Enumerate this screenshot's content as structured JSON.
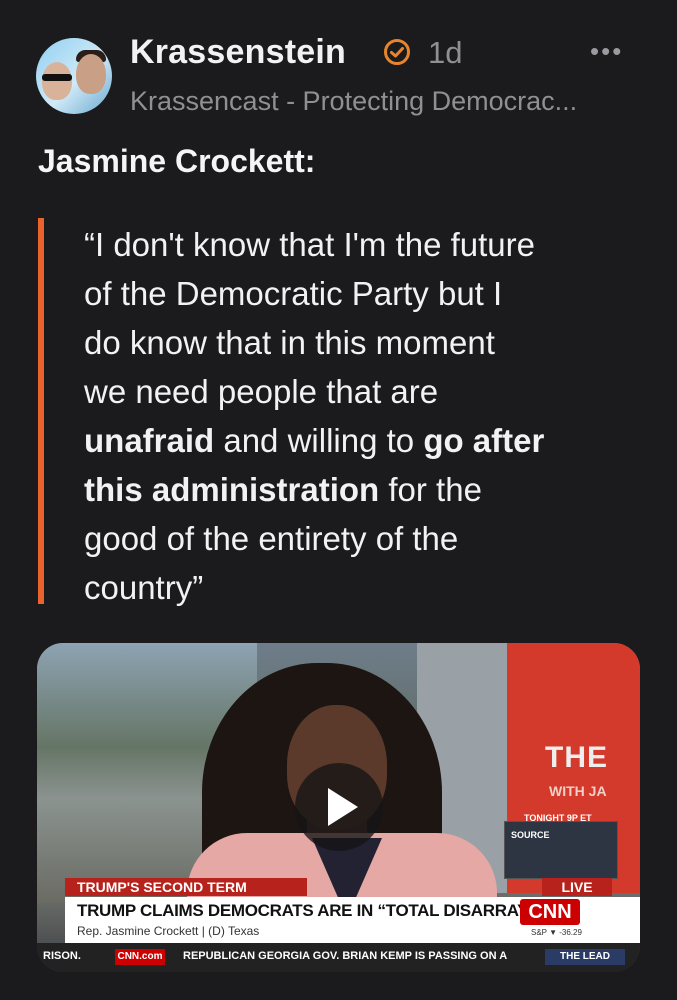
{
  "post": {
    "author": "Krassenstein",
    "age": "1d",
    "subtitle": "Krassencast - Protecting Democrac...",
    "more_label": "•••",
    "heading": "Jasmine Crockett:",
    "quote_lines": [
      [
        "“I don't know that I'm the future",
        ""
      ],
      [
        "of the Democratic Party but I",
        ""
      ],
      [
        "do know that in this moment",
        ""
      ],
      [
        "we need people that are",
        ""
      ],
      [
        "unafraid",
        " and willing to ",
        "go after"
      ],
      [
        "this administration",
        " for the"
      ],
      [
        "good of the entirety of the",
        ""
      ],
      [
        "country”",
        ""
      ]
    ],
    "accent_color": "#e8642c"
  },
  "video": {
    "topic": "TRUMP'S SECOND TERM",
    "live": "LIVE",
    "headline": "TRUMP CLAIMS DEMOCRATS ARE IN “TOTAL DISARRAY”",
    "name_line": "Rep. Jasmine Crockett  |  (D) Texas",
    "network": "CNN",
    "stock": "S&P ▼ -36.29",
    "tonight": "TONIGHT 9P ET",
    "source": "SOURCE",
    "the": "THE",
    "with": "WITH JA",
    "ticker_left": "RISON.",
    "ticker_cnn": "CNN.com",
    "ticker_text": "REPUBLICAN GEORGIA GOV. BRIAN KEMP IS PASSING ON A",
    "ticker_right": "THE LEAD"
  }
}
